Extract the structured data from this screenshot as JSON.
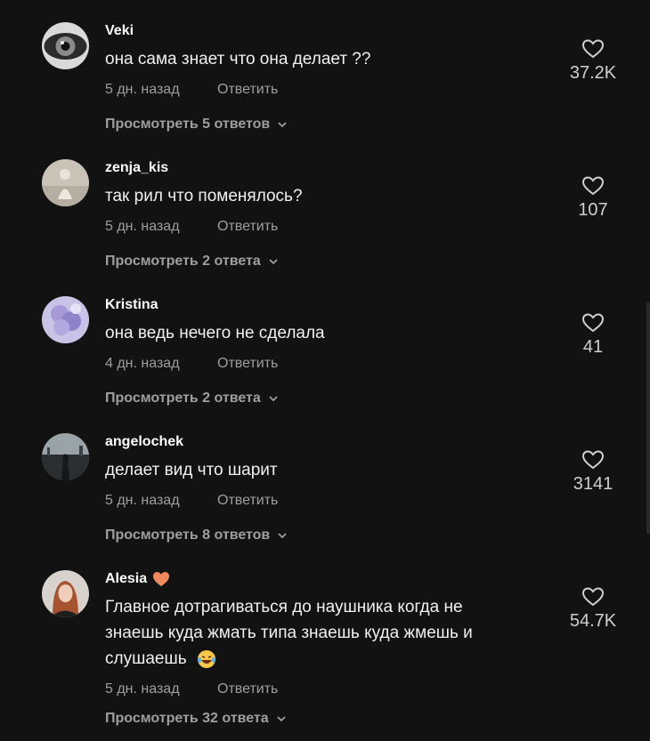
{
  "comments": [
    {
      "username": "Veki",
      "text": "она сама знает что она делает ??",
      "date": "5 дн. назад",
      "reply": "Ответить",
      "replies": "Просмотреть 5 ответов",
      "likes": "37.2K"
    },
    {
      "username": "zenja_kis",
      "text": "так рил что поменялось?",
      "date": "5 дн. назад",
      "reply": "Ответить",
      "replies": "Просмотреть 2 ответа",
      "likes": "107"
    },
    {
      "username": "Kristina",
      "text": "она ведь нечего не сделала",
      "date": "4 дн. назад",
      "reply": "Ответить",
      "replies": "Просмотреть 2 ответа",
      "likes": "41"
    },
    {
      "username": "angelochek",
      "text": "делает вид что шарит",
      "date": "5 дн. назад",
      "reply": "Ответить",
      "replies": "Просмотреть 8 ответов",
      "likes": "3141"
    },
    {
      "username": "Alesia",
      "text_line1": "Главное дотрагиваться до наушника когда не",
      "text_line2": "знаешь куда жмать типа знаешь куда жмешь и",
      "text_line3": "слушаешь",
      "date": "5 дн. назад",
      "reply": "Ответить",
      "replies": "Просмотреть 32 ответа",
      "likes": "54.7K",
      "name_emoji": "orange-heart-icon",
      "text_emoji": "laughing-emoji-icon"
    }
  ],
  "colors": {
    "background": "#121212",
    "muted": "#9e9e9e",
    "heart_emoji": "#f08a5d"
  }
}
